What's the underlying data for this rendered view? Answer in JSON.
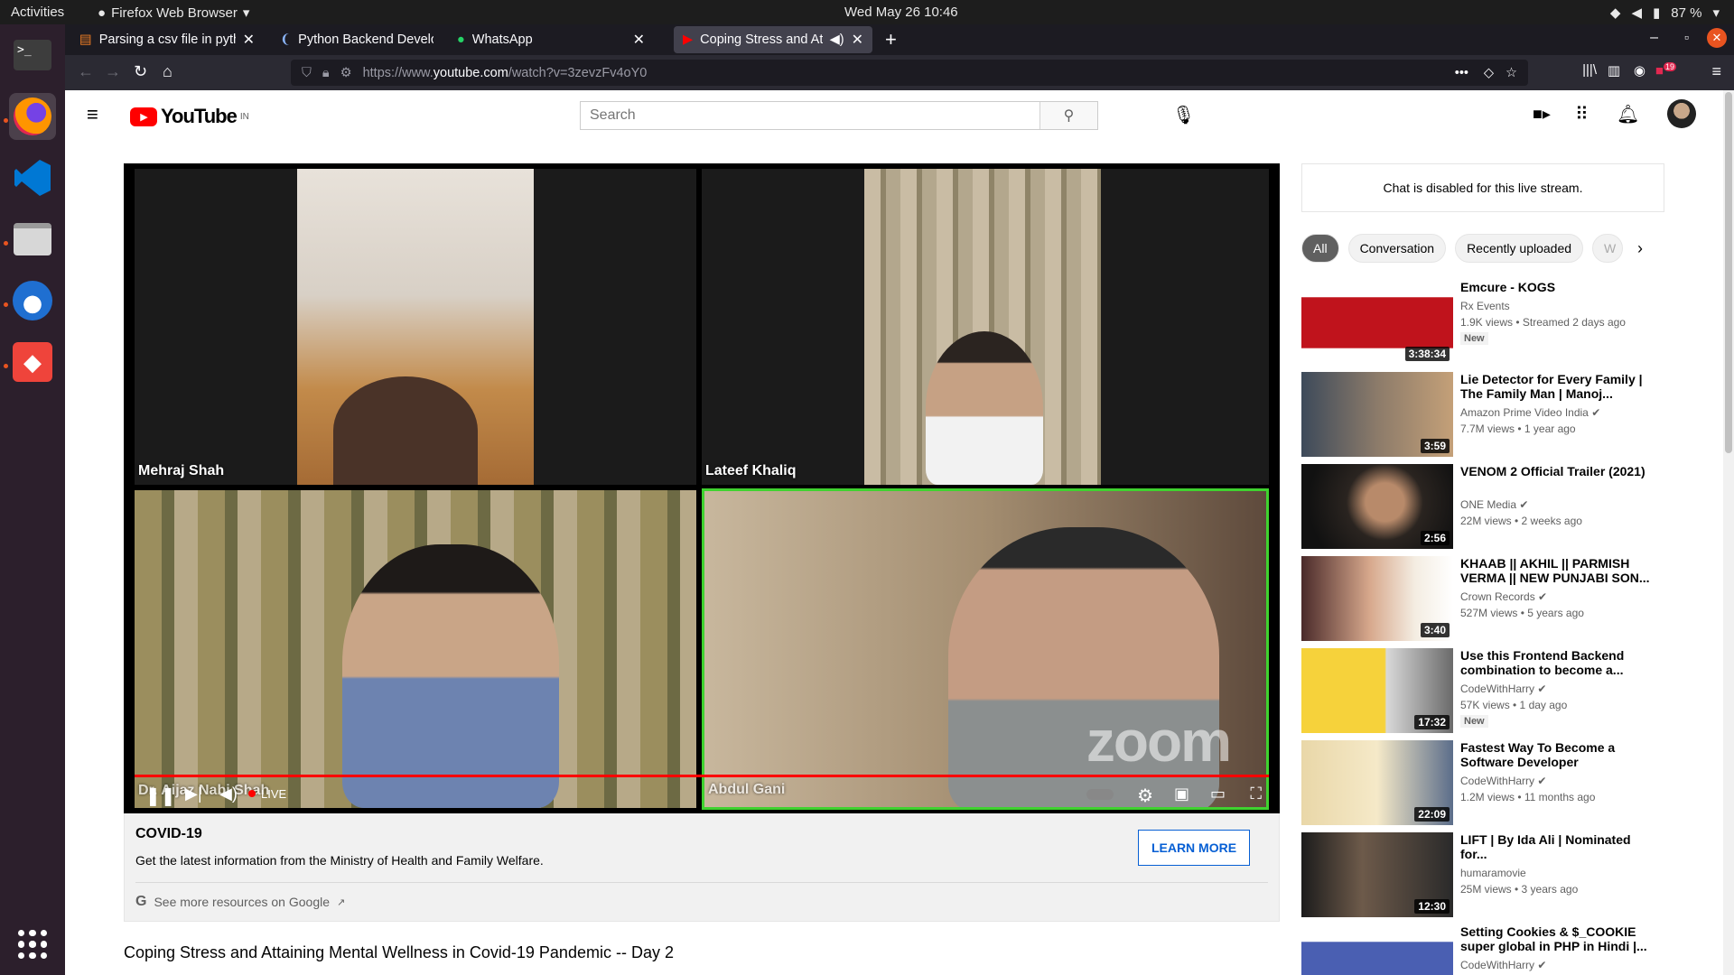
{
  "system": {
    "activities": "Activities",
    "app_name": "Firefox Web Browser",
    "clock": "Wed May 26  10:46",
    "battery": "87 %"
  },
  "browser": {
    "tabs": [
      {
        "title": "Parsing a csv file in pytho"
      },
      {
        "title": "Python Backend Develop"
      },
      {
        "title": "WhatsApp"
      },
      {
        "title": "Coping Stress and Atta"
      }
    ],
    "url_scheme": "https://www.",
    "url_host": "youtube.com",
    "url_path": "/watch?v=3zevzFv4oY0",
    "notification_count": "19"
  },
  "youtube": {
    "logo_text": "YouTube",
    "region": "IN",
    "search_placeholder": "Search",
    "player": {
      "participants": [
        "Mehraj Shah",
        "Lateef Khaliq",
        "Dr. Aijaz Nabi Shah",
        "Abdul Gani"
      ],
      "live_label": "LIVE",
      "watermark": "zoom",
      "progress": 1.0
    },
    "covid": {
      "heading": "COVID-19",
      "text": "Get the latest information from the Ministry of Health and Family Welfare.",
      "button": "LEARN MORE",
      "link": "See more resources on Google"
    },
    "video_title": "Coping Stress and Attaining Mental Wellness in Covid-19 Pandemic -- Day 2",
    "chat_disabled": "Chat is disabled for this live stream.",
    "chips": [
      "All",
      "Conversation",
      "Recently uploaded",
      "W"
    ],
    "recommendations": [
      {
        "title": "Emcure - KOGS",
        "channel": "Rx Events",
        "meta": "1.9K views • Streamed 2 days ago",
        "badge": "New",
        "duration": "3:38:34"
      },
      {
        "title": "Lie Detector for Every Family | The Family Man | Manoj...",
        "channel": "Amazon Prime Video India",
        "meta": "7.7M views • 1 year ago",
        "badge": "",
        "duration": "3:59"
      },
      {
        "title": "VENOM 2 Official Trailer (2021)",
        "channel": "ONE Media",
        "meta": "22M views • 2 weeks ago",
        "badge": "",
        "duration": "2:56"
      },
      {
        "title": "KHAAB || AKHIL || PARMISH VERMA || NEW PUNJABI SON...",
        "channel": "Crown Records",
        "meta": "527M views • 5 years ago",
        "badge": "",
        "duration": "3:40"
      },
      {
        "title": "Use this Frontend Backend combination to become a...",
        "channel": "CodeWithHarry",
        "meta": "57K views • 1 day ago",
        "badge": "New",
        "duration": "17:32"
      },
      {
        "title": "Fastest Way To Become a Software Developer",
        "channel": "CodeWithHarry",
        "meta": "1.2M views • 11 months ago",
        "badge": "",
        "duration": "22:09"
      },
      {
        "title": "LIFT | By Ida Ali | Nominated for...",
        "channel": "humaramovie",
        "meta": "25M views • 3 years ago",
        "badge": "",
        "duration": "12:30"
      },
      {
        "title": "Setting Cookies & $_COOKIE super global in PHP in Hindi |...",
        "channel": "CodeWithHarry",
        "meta": "",
        "badge": "",
        "duration": ""
      }
    ]
  }
}
